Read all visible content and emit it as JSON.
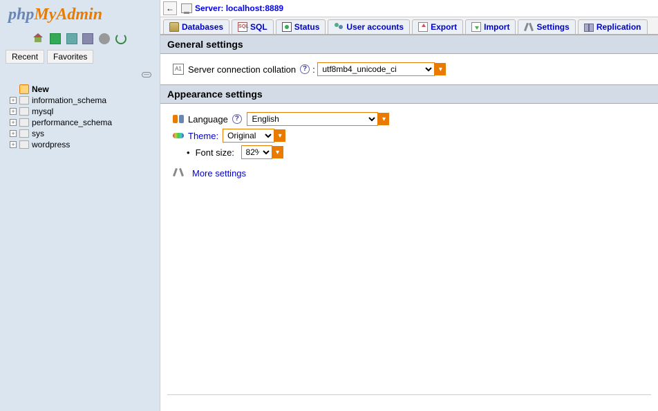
{
  "logo": {
    "part1": "php",
    "part2": "MyAdmin"
  },
  "sidebar_tabs": {
    "recent": "Recent",
    "favorites": "Favorites"
  },
  "tree": {
    "new_label": "New",
    "databases": [
      "information_schema",
      "mysql",
      "performance_schema",
      "sys",
      "wordpress"
    ]
  },
  "server": {
    "prefix": "Server: ",
    "value": "localhost:8889"
  },
  "tabs": {
    "databases": "Databases",
    "sql": "SQL",
    "status": "Status",
    "users": "User accounts",
    "export": "Export",
    "import": "Import",
    "settings": "Settings",
    "replication": "Replication"
  },
  "general": {
    "header": "General settings",
    "collation_label": "Server connection collation",
    "collation_value": "utf8mb4_unicode_ci"
  },
  "appearance": {
    "header": "Appearance settings",
    "language_label": "Language",
    "language_value": "English",
    "theme_label": "Theme:",
    "theme_value": "Original",
    "fontsize_label": "Font size:",
    "fontsize_value": "82%"
  },
  "more_settings": "More settings",
  "colon": ":"
}
